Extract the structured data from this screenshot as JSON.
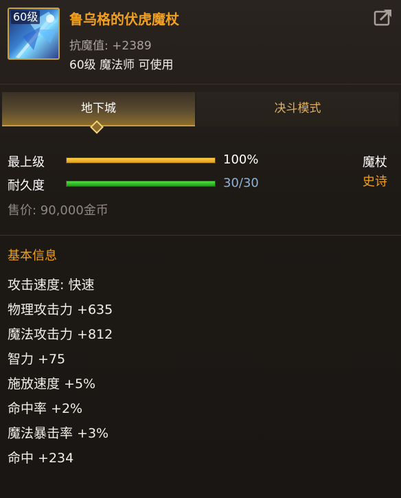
{
  "item": {
    "level_badge": "60级",
    "name": "鲁乌格的伏虎魔杖",
    "resist_line": "抗魔值: +2389",
    "requirement": "60级 魔法师 可使用",
    "icon": "staff-icon"
  },
  "share_icon": "share-icon",
  "tabs": [
    {
      "label": "地下城",
      "active": true
    },
    {
      "label": "决斗模式",
      "active": false
    }
  ],
  "stats": {
    "level": {
      "label": "最上级",
      "value_text": "100%",
      "fill": 1.0
    },
    "durability": {
      "label": "耐久度",
      "value_text": "30/30",
      "fill": 1.0
    }
  },
  "type": "魔杖",
  "rarity": "史诗",
  "price": "售价: 90,000金币",
  "basic_info": {
    "title": "基本信息",
    "lines": [
      "攻击速度: 快速",
      "物理攻击力 +635",
      "魔法攻击力 +812",
      "智力 +75",
      "施放速度 +5%",
      "命中率 +2%",
      "魔法暴击率 +3%",
      "命中 +234"
    ]
  },
  "colors": {
    "epic": "#f0a020",
    "level_bar": "#f0b020",
    "durability_bar": "#3ac02a",
    "durability_text": "#8fb0d8"
  }
}
